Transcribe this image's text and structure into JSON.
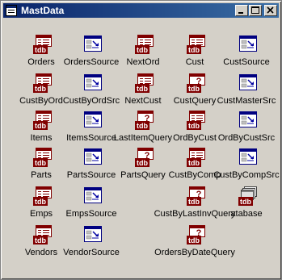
{
  "window": {
    "title": "MastData"
  },
  "colors": {
    "title_active": "#0a246a",
    "tdb_red": "#800000",
    "source_blue": "#0000a0"
  },
  "components": [
    {
      "label": "Orders",
      "kind": "table"
    },
    {
      "label": "OrdersSource",
      "kind": "source"
    },
    {
      "label": "NextOrd",
      "kind": "table"
    },
    {
      "label": "Cust",
      "kind": "table"
    },
    {
      "label": "CustSource",
      "kind": "source"
    },
    {
      "label": "CustByOrd",
      "kind": "table"
    },
    {
      "label": "CustByOrdSrc",
      "kind": "source"
    },
    {
      "label": "NextCust",
      "kind": "table"
    },
    {
      "label": "CustQuery",
      "kind": "query"
    },
    {
      "label": "CustMasterSrc",
      "kind": "source"
    },
    {
      "label": "Items",
      "kind": "table"
    },
    {
      "label": "ItemsSource",
      "kind": "source"
    },
    {
      "label": "LastItemQuery",
      "kind": "query"
    },
    {
      "label": "OrdByCust",
      "kind": "table"
    },
    {
      "label": "OrdByCustSrc",
      "kind": "source"
    },
    {
      "label": "Parts",
      "kind": "table"
    },
    {
      "label": "PartsSource",
      "kind": "source"
    },
    {
      "label": "PartsQuery",
      "kind": "query"
    },
    {
      "label": "CustByComp",
      "kind": "table"
    },
    {
      "label": "CustByCompSrc",
      "kind": "source"
    },
    {
      "label": "Emps",
      "kind": "table"
    },
    {
      "label": "EmpsSource",
      "kind": "source"
    },
    {
      "label": "CustByLastInvQuery",
      "kind": "query"
    },
    {
      "label": "atabase",
      "kind": "database"
    },
    {
      "label": "Vendors",
      "kind": "table"
    },
    {
      "label": "VendorSource",
      "kind": "source"
    },
    {
      "label": "OrdersByDateQuery",
      "kind": "query"
    }
  ]
}
